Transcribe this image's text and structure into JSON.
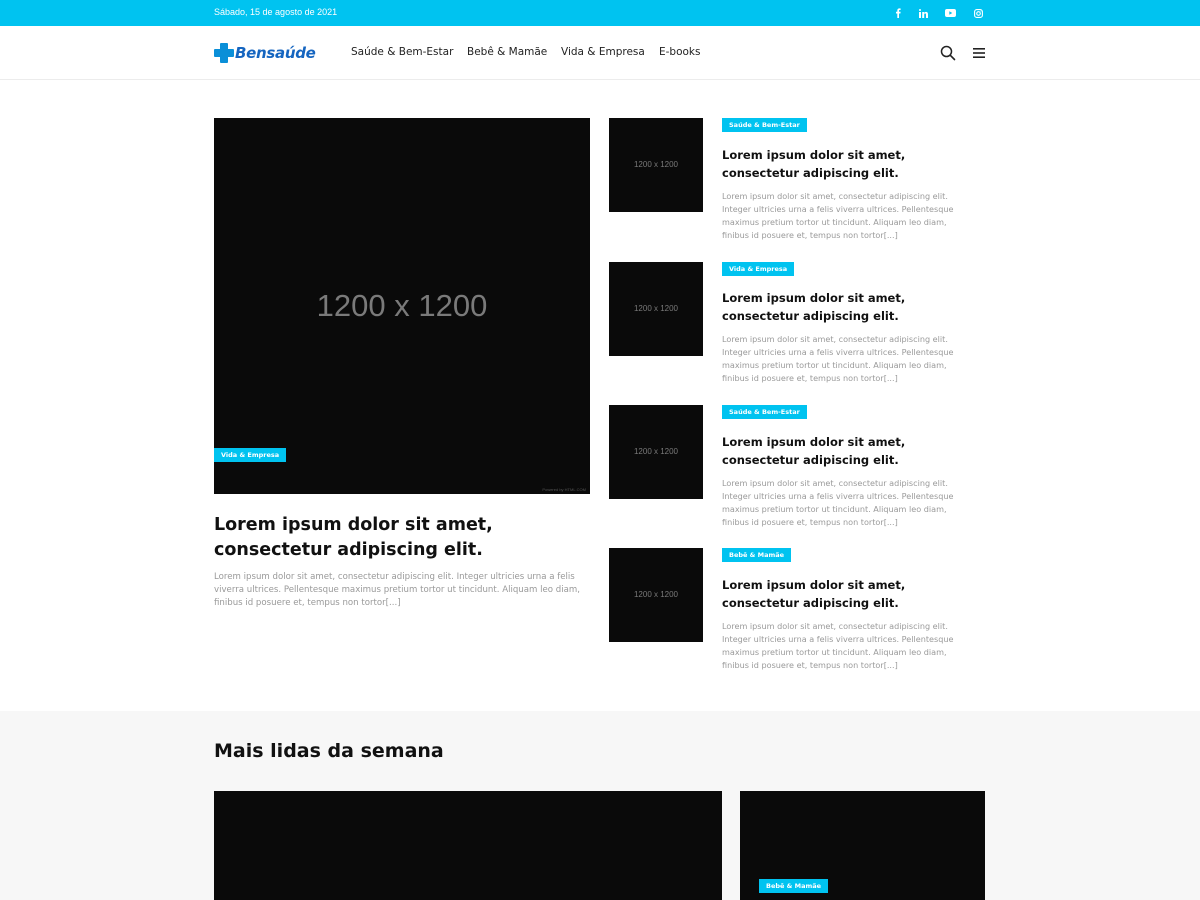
{
  "topbar": {
    "date": "Sábado, 15 de agosto de 2021",
    "social": [
      {
        "icon": "facebook-icon",
        "name": "facebook"
      },
      {
        "icon": "linkedin-icon",
        "name": "linkedin"
      },
      {
        "icon": "youtube-icon",
        "name": "youtube"
      },
      {
        "icon": "instagram-icon",
        "name": "instagram"
      }
    ]
  },
  "header": {
    "logo_text": "Bensaúde",
    "nav": [
      "Saúde & Bem-Estar",
      "Bebê & Mamãe",
      "Vida & Empresa",
      "E-books"
    ],
    "search_icon": "search-icon",
    "menu_icon": "hamburger-menu-icon"
  },
  "featured": {
    "image_label": "1200 x 1200",
    "image_credit": "Powered by HTML.COM",
    "category": "Vida & Empresa",
    "title": "Lorem ipsum dolor sit amet, consectetur adipiscing elit.",
    "excerpt": "Lorem ipsum dolor sit amet, consectetur adipiscing elit. Integer ultricies urna a felis viverra ultrices. Pellentesque maximus pretium tortor ut tincidunt. Aliquam leo diam, finibus id posuere et, tempus non tortor[...]"
  },
  "side_posts": [
    {
      "image_label": "1200 x 1200",
      "category": "Saúde & Bem-Estar",
      "title": "Lorem ipsum dolor sit amet, consectetur adipiscing elit.",
      "excerpt": "Lorem ipsum dolor sit amet, consectetur adipiscing elit. Integer ultricies urna a felis viverra ultrices. Pellentesque maximus pretium tortor ut tincidunt. Aliquam leo diam, finibus id posuere et, tempus non tortor[...]"
    },
    {
      "image_label": "1200 x 1200",
      "category": "Vida & Empresa",
      "title": "Lorem ipsum dolor sit amet, consectetur adipiscing elit.",
      "excerpt": "Lorem ipsum dolor sit amet, consectetur adipiscing elit. Integer ultricies urna a felis viverra ultrices. Pellentesque maximus pretium tortor ut tincidunt. Aliquam leo diam, finibus id posuere et, tempus non tortor[...]"
    },
    {
      "image_label": "1200 x 1200",
      "category": "Saúde & Bem-Estar",
      "title": "Lorem ipsum dolor sit amet, consectetur adipiscing elit.",
      "excerpt": "Lorem ipsum dolor sit amet, consectetur adipiscing elit. Integer ultricies urna a felis viverra ultrices. Pellentesque maximus pretium tortor ut tincidunt. Aliquam leo diam, finibus id posuere et, tempus non tortor[...]"
    },
    {
      "image_label": "1200 x 1200",
      "category": "Bebê & Mamãe",
      "title": "Lorem ipsum dolor sit amet, consectetur adipiscing elit.",
      "excerpt": "Lorem ipsum dolor sit amet, consectetur adipiscing elit. Integer ultricies urna a felis viverra ultrices. Pellentesque maximus pretium tortor ut tincidunt. Aliquam leo diam, finibus id posuere et, tempus non tortor[...]"
    }
  ],
  "most_read": {
    "heading": "Mais lidas da semana",
    "cards": [
      {
        "category": ""
      },
      {
        "category": "Bebê & Mamãe"
      }
    ]
  },
  "colors": {
    "accent": "#00c3f0",
    "logo": "#1565c0",
    "image_bg": "#0a0a0a",
    "section_bg": "#f7f7f7"
  }
}
